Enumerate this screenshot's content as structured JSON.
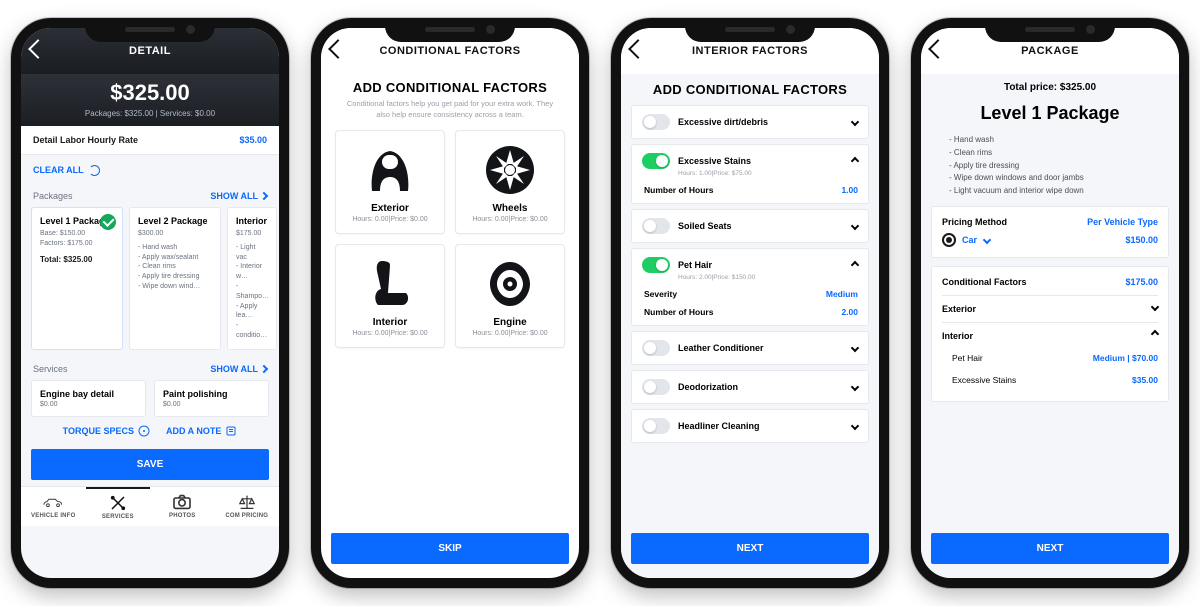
{
  "colors": {
    "blue": "#0a69ff",
    "dark": "#1a1d22"
  },
  "screen1": {
    "title": "DETAIL",
    "hero_price": "$325.00",
    "hero_sub": "Packages: $325.00 | Services: $0.00",
    "hourly_label": "Detail Labor Hourly Rate",
    "hourly_value": "$35.00",
    "clear_all": "CLEAR ALL",
    "packages_label": "Packages",
    "show_all": "SHOW ALL",
    "packages": [
      {
        "name": "Level 1 Package",
        "line1": "Base: $150.00",
        "line2": "Factors: $175.00",
        "total": "Total: $325.00",
        "selected": true
      },
      {
        "name": "Level 2 Package",
        "line1": "$300.00",
        "bullets": "- Hand wash\n- Apply wax/sealant\n- Clean rims\n- Apply tire dressing\n- Wipe down wind…",
        "selected": false
      },
      {
        "name": "Interior",
        "line1": "$175.00",
        "bullets": "- Light vac\n- Interior w…\n- Shampo…\n- Apply lea…\n- conditio…",
        "selected": false
      }
    ],
    "services_label": "Services",
    "services": [
      {
        "name": "Engine bay detail",
        "price": "$0.00"
      },
      {
        "name": "Paint polishing",
        "price": "$0.00"
      }
    ],
    "torque": "TORQUE SPECS",
    "addnote": "ADD A NOTE",
    "save": "SAVE",
    "tabs": [
      "VEHICLE INFO",
      "SERVICES",
      "PHOTOS",
      "COM PRICING"
    ],
    "active_tab": 1
  },
  "screen2": {
    "title": "CONDITIONAL FACTORS",
    "heading": "ADD CONDITIONAL FACTORS",
    "desc": "Conditional factors help you get paid for your extra work. They also help ensure consistency across a team.",
    "cards": [
      {
        "name": "Exterior",
        "sub": "Hours: 0.00|Price: $0.00",
        "icon": "car-hood-icon"
      },
      {
        "name": "Wheels",
        "sub": "Hours: 0.00|Price: $0.00",
        "icon": "wheel-icon"
      },
      {
        "name": "Interior",
        "sub": "Hours: 0.00|Price: $0.00",
        "icon": "seat-icon"
      },
      {
        "name": "Engine",
        "sub": "Hours: 0.00|Price: $0.00",
        "icon": "engine-icon"
      }
    ],
    "skip": "SKIP"
  },
  "screen3": {
    "title": "INTERIOR FACTORS",
    "heading": "ADD CONDITIONAL FACTORS",
    "factors": [
      {
        "name": "Excessive dirt/debris",
        "on": false,
        "expanded": false
      },
      {
        "name": "Excessive Stains",
        "on": true,
        "expanded": true,
        "sub": "Hours: 1.00|Price: $75.00",
        "rows": [
          {
            "k": "Number of Hours",
            "v": "1.00"
          }
        ]
      },
      {
        "name": "Soiled Seats",
        "on": false,
        "expanded": false
      },
      {
        "name": "Pet Hair",
        "on": true,
        "expanded": true,
        "sub": "Hours: 2.00|Price: $150.00",
        "rows": [
          {
            "k": "Severity",
            "v": "Medium"
          },
          {
            "k": "Number of Hours",
            "v": "2.00"
          }
        ]
      },
      {
        "name": "Leather Conditioner",
        "on": false,
        "expanded": false
      },
      {
        "name": "Deodorization",
        "on": false,
        "expanded": false
      },
      {
        "name": "Headliner Cleaning",
        "on": false,
        "expanded": false
      }
    ],
    "next": "NEXT"
  },
  "screen4": {
    "title": "PACKAGE",
    "total_label": "Total price: $325.00",
    "package_name": "Level 1 Package",
    "bullets": [
      "- Hand wash",
      "- Clean rims",
      "- Apply tire dressing",
      "- Wipe down windows and door jambs",
      "- Light vacuum and interior wipe down"
    ],
    "pricing_method_label": "Pricing Method",
    "pricing_method_value": "Per Vehicle Type",
    "vehicle": "Car",
    "vehicle_price": "$150.00",
    "cond_label": "Conditional Factors",
    "cond_total": "$175.00",
    "groups": [
      {
        "name": "Exterior",
        "expanded": false
      },
      {
        "name": "Interior",
        "expanded": true,
        "items": [
          {
            "name": "Pet Hair",
            "value": "Medium | $70.00"
          },
          {
            "name": "Excessive Stains",
            "value": "$35.00"
          }
        ]
      }
    ],
    "next": "NEXT"
  }
}
